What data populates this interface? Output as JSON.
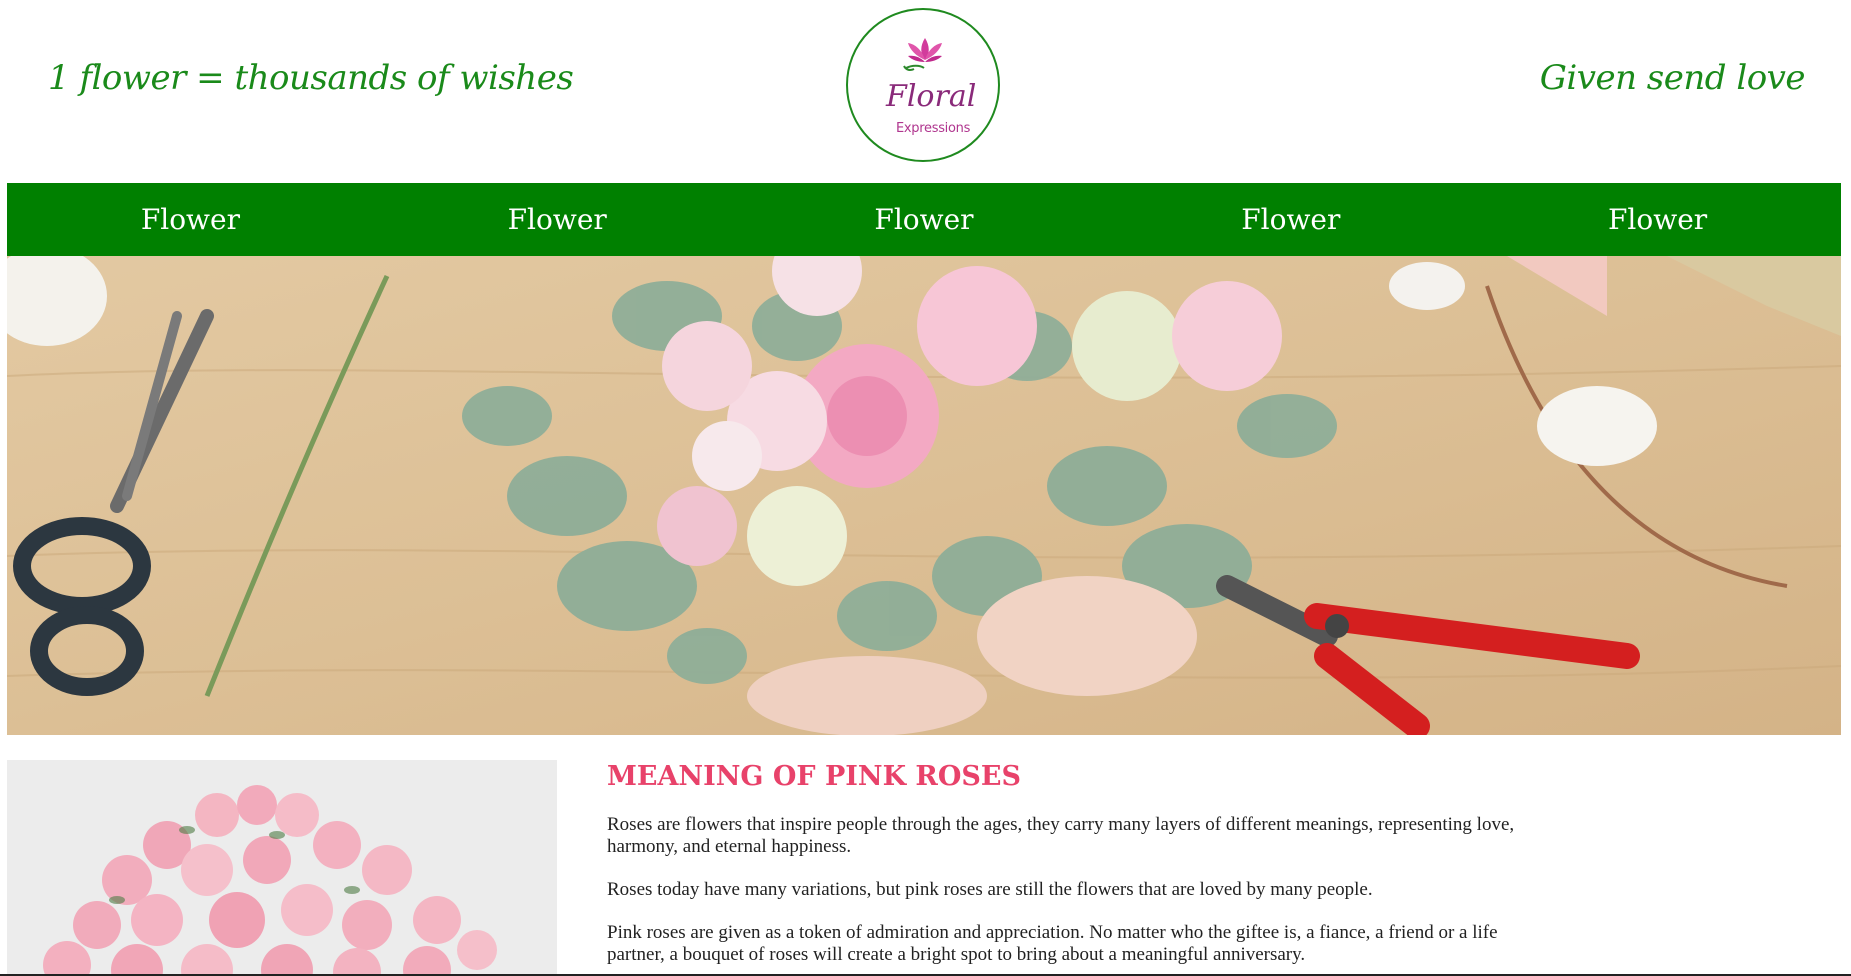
{
  "header": {
    "tagline_left": "1 flower = thousands of wishes",
    "tagline_right": "Given send love",
    "logo": {
      "word1": "Floral",
      "word2": "Expressions"
    }
  },
  "nav": {
    "items": [
      {
        "label": "Flower"
      },
      {
        "label": "Flower"
      },
      {
        "label": "Flower"
      },
      {
        "label": "Flower"
      },
      {
        "label": "Flower"
      }
    ]
  },
  "article": {
    "title": "MEANING OF PINK ROSES",
    "paragraphs": [
      "Roses are flowers that inspire people through the ages, they carry many layers of different meanings, representing love, harmony, and eternal happiness.",
      "Roses today have many variations, but pink roses are still the flowers that are loved by many people.",
      "Pink roses are given as a token of admiration and appreciation. No matter who the giftee is, a fiance, a friend or a life partner, a bouquet of roses will create a bright spot to bring about a meaningful anniversary."
    ]
  },
  "colors": {
    "brand_green": "#008000",
    "tagline_green": "#1a8a1a",
    "heading_pink": "#e8426a",
    "logo_magenta": "#b0368f"
  }
}
